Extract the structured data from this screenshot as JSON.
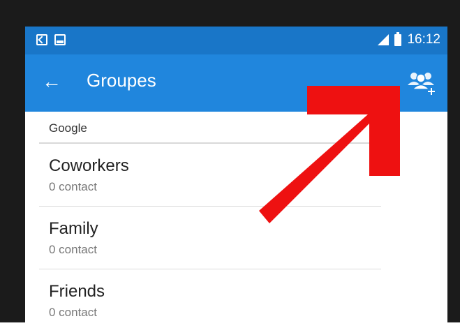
{
  "status_bar": {
    "time": "16:12",
    "icons": [
      "screenshot-icon",
      "image-icon",
      "signal-icon",
      "battery-icon"
    ]
  },
  "app_bar": {
    "title": "Groupes",
    "back_icon": "←",
    "action_icon": "add-group-icon"
  },
  "section": {
    "header": "Google"
  },
  "groups": [
    {
      "name": "Coworkers",
      "count": "0 contact"
    },
    {
      "name": "Family",
      "count": "0 contact"
    },
    {
      "name": "Friends",
      "count": "0 contact"
    }
  ],
  "colors": {
    "status_bar": "#1976c8",
    "app_bar": "#2086dd",
    "annotation_arrow": "#ee1111"
  }
}
